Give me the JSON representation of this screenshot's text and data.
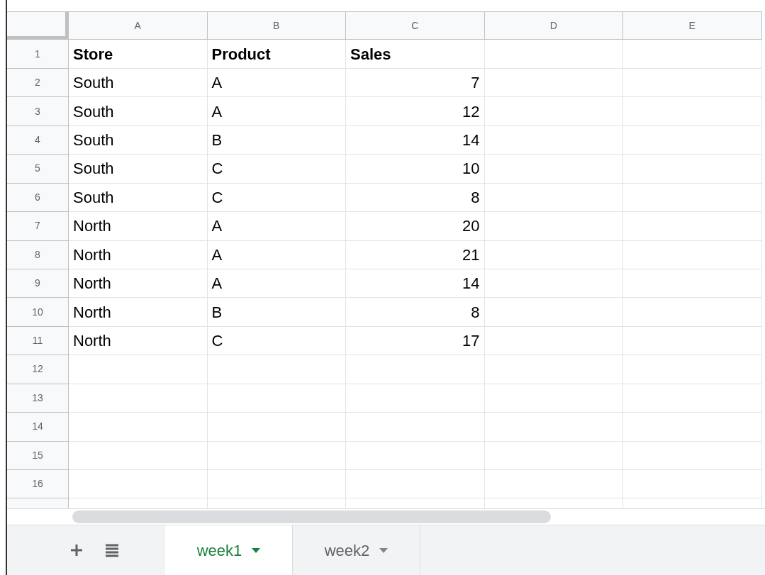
{
  "columns": [
    "A",
    "B",
    "C",
    "D",
    "E"
  ],
  "rows": [
    {
      "number": "1",
      "kind": "header",
      "cells": [
        "Store",
        "Product",
        "Sales"
      ]
    },
    {
      "number": "2",
      "kind": "data",
      "cells": [
        "South",
        "A",
        "7"
      ]
    },
    {
      "number": "3",
      "kind": "data",
      "cells": [
        "South",
        "A",
        "12"
      ]
    },
    {
      "number": "4",
      "kind": "data",
      "cells": [
        "South",
        "B",
        "14"
      ]
    },
    {
      "number": "5",
      "kind": "data",
      "cells": [
        "South",
        "C",
        "10"
      ]
    },
    {
      "number": "6",
      "kind": "data",
      "cells": [
        "South",
        "C",
        "8"
      ]
    },
    {
      "number": "7",
      "kind": "data",
      "cells": [
        "North",
        "A",
        "20"
      ]
    },
    {
      "number": "8",
      "kind": "data",
      "cells": [
        "North",
        "A",
        "21"
      ]
    },
    {
      "number": "9",
      "kind": "data",
      "cells": [
        "North",
        "A",
        "14"
      ]
    },
    {
      "number": "10",
      "kind": "data",
      "cells": [
        "North",
        "B",
        "8"
      ]
    },
    {
      "number": "11",
      "kind": "data",
      "cells": [
        "North",
        "C",
        "17"
      ]
    },
    {
      "number": "12"
    },
    {
      "number": "13"
    },
    {
      "number": "14"
    },
    {
      "number": "15"
    },
    {
      "number": "16"
    }
  ],
  "sheet_tabs": [
    {
      "label": "week1",
      "selected": true
    },
    {
      "label": "week2",
      "selected": false
    }
  ]
}
